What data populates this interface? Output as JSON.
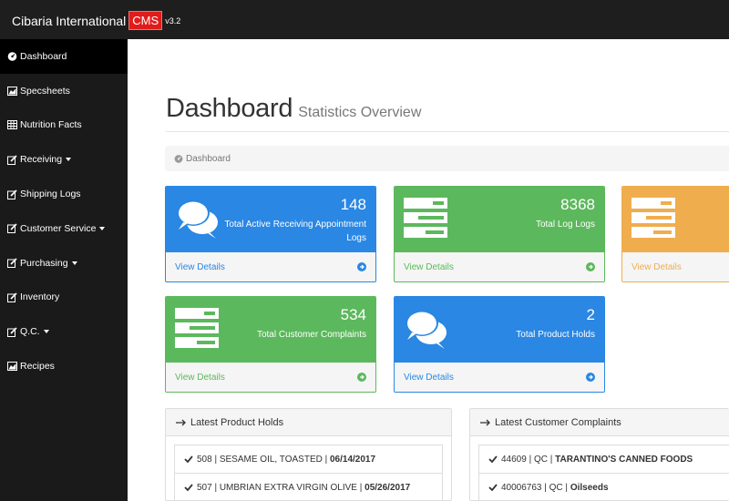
{
  "brand": {
    "name": "Cibaria International",
    "badge": "CMS",
    "version": "v3.2"
  },
  "sidebar": {
    "items": [
      {
        "label": "Dashboard",
        "icon": "dashboard-icon",
        "dropdown": false,
        "active": true
      },
      {
        "label": "Specsheets",
        "icon": "area-chart-icon",
        "dropdown": false
      },
      {
        "label": "Nutrition Facts",
        "icon": "table-icon",
        "dropdown": false
      },
      {
        "label": "Receiving",
        "icon": "edit-icon",
        "dropdown": true
      },
      {
        "label": "Shipping Logs",
        "icon": "edit-icon",
        "dropdown": false
      },
      {
        "label": "Customer Service",
        "icon": "edit-icon",
        "dropdown": true
      },
      {
        "label": "Purchasing",
        "icon": "edit-icon",
        "dropdown": true
      },
      {
        "label": "Inventory",
        "icon": "edit-icon",
        "dropdown": false
      },
      {
        "label": "Q.C.",
        "icon": "edit-icon",
        "dropdown": true
      },
      {
        "label": "Recipes",
        "icon": "area-chart-icon",
        "dropdown": false
      }
    ]
  },
  "header": {
    "title": "Dashboard",
    "subtitle": "Statistics Overview"
  },
  "breadcrumb": {
    "label": "Dashboard"
  },
  "panels": [
    {
      "count": "148",
      "label": "Total Active Receiving Appointment Logs",
      "link": "View Details",
      "color": "#2a87e3",
      "icon": "comments-icon"
    },
    {
      "count": "8368",
      "label": "Total Log Logs",
      "link": "View Details",
      "color": "#5cb85c",
      "icon": "tasks-icon"
    },
    {
      "count": "",
      "label": "",
      "link": "View Details",
      "color": "#f0ad4e",
      "icon": "tasks-icon"
    },
    {
      "count": "534",
      "label": "Total Customer Complaints",
      "link": "View Details",
      "color": "#5cb85c",
      "icon": "tasks-icon"
    },
    {
      "count": "2",
      "label": "Total Product Holds",
      "link": "View Details",
      "color": "#2a87e3",
      "icon": "comments-icon"
    }
  ],
  "product_holds": {
    "title": "Latest Product Holds",
    "rows": [
      {
        "prefix": "508 | SESAME OIL, TOASTED | ",
        "bold": "06/14/2017"
      },
      {
        "prefix": "507 | UMBRIAN EXTRA VIRGIN OLIVE | ",
        "bold": "05/26/2017"
      }
    ]
  },
  "complaints": {
    "title": "Latest Customer Complaints",
    "rows": [
      {
        "prefix": "44609 | QC | ",
        "bold": "TARANTINO'S CANNED FOODS"
      },
      {
        "prefix": "40006763 | QC | ",
        "bold": "Oilseeds"
      }
    ]
  }
}
